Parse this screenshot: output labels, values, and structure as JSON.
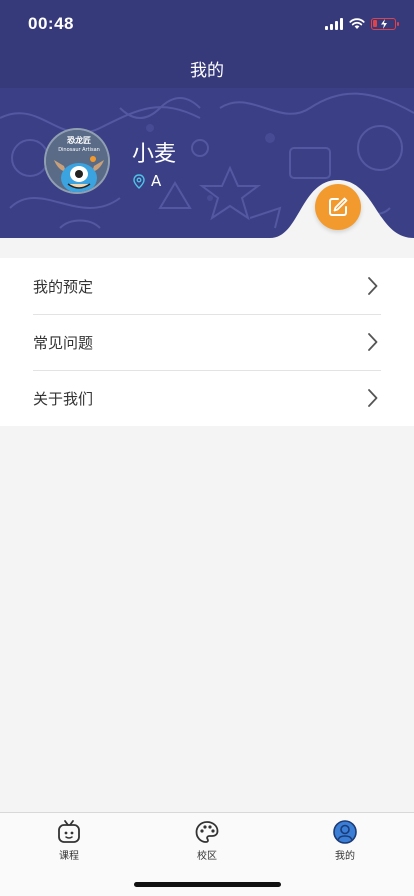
{
  "status": {
    "time": "00:48"
  },
  "nav": {
    "title": "我的"
  },
  "profile": {
    "name": "小麦",
    "location": "A",
    "avatar_text_cn": "恐龙匠",
    "avatar_text_en": "Dinosaur Artisan"
  },
  "menu": {
    "items": [
      {
        "label": "我的预定"
      },
      {
        "label": "常见问题"
      },
      {
        "label": "关于我们"
      }
    ]
  },
  "tabs": [
    {
      "label": "课程",
      "icon": "tv-icon"
    },
    {
      "label": "校区",
      "icon": "palette-icon"
    },
    {
      "label": "我的",
      "icon": "user-icon",
      "active": true
    }
  ],
  "colors": {
    "header": "#36397a",
    "banner": "#3a3f86",
    "accent_orange": "#f39a2e",
    "active_tab": "#3b7ed6"
  }
}
